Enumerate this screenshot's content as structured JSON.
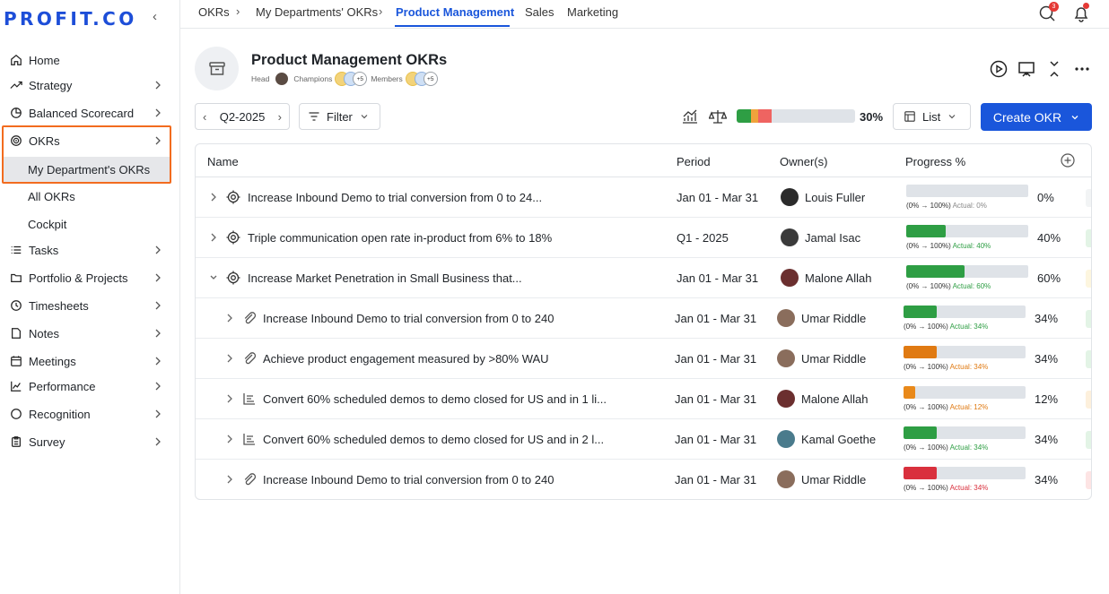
{
  "brand": {
    "logo_text": "PROFIT.CO",
    "accent": "#1a56db",
    "highlight": "#f26c1f"
  },
  "sidebar": {
    "items": [
      {
        "label": "Home",
        "icon": "home-icon",
        "chevron": false
      },
      {
        "label": "Strategy",
        "icon": "trend-up-icon",
        "chevron": true
      },
      {
        "label": "Balanced Scorecard",
        "icon": "pie-chart-icon",
        "chevron": true
      },
      {
        "label": "OKRs",
        "icon": "target-icon",
        "chevron": true
      },
      {
        "label": "Tasks",
        "icon": "list-icon",
        "chevron": true
      },
      {
        "label": "Portfolio & Projects",
        "icon": "folder-icon",
        "chevron": true
      },
      {
        "label": "Timesheets",
        "icon": "clock-icon",
        "chevron": true
      },
      {
        "label": "Notes",
        "icon": "note-icon",
        "chevron": true
      },
      {
        "label": "Meetings",
        "icon": "calendar-icon",
        "chevron": true
      },
      {
        "label": "Performance",
        "icon": "chart-icon",
        "chevron": true
      },
      {
        "label": "Recognition",
        "icon": "circle-icon",
        "chevron": true
      },
      {
        "label": "Survey",
        "icon": "clipboard-icon",
        "chevron": true
      }
    ],
    "okr_subitems": [
      "My Department's OKRs",
      "All OKRs",
      "Cockpit"
    ]
  },
  "topbar": {
    "tabs": [
      "OKRs",
      "My Departments' OKRs",
      "Product Management",
      "Sales",
      "Marketing"
    ],
    "active_tab": "Product Management",
    "notification_count": "3"
  },
  "header": {
    "title": "Product Management OKRs",
    "head_label": "Head",
    "champions_label": "Champions",
    "champions_more": "+5",
    "members_label": "Members",
    "members_more": "+5"
  },
  "toolbar": {
    "period": "Q2-2025",
    "filter_label": "Filter",
    "overall_progress": "30%",
    "view_label": "List",
    "create_label": "Create OKR"
  },
  "table": {
    "columns": [
      "Name",
      "Period",
      "Owner(s)",
      "Progress %"
    ],
    "rows": [
      {
        "level": 0,
        "expanded": false,
        "type": "objective",
        "name": "Increase Inbound Demo to trial conversion from 0 to 24...",
        "period": "Jan 01 - Mar 31",
        "owner": "Louis Fuller",
        "progress": 0,
        "bar_color": "#2e9e44",
        "range": "(0% → 100%)",
        "actual": "Actual: 0%",
        "actual_color": "#888888",
        "pct": "0%",
        "edge": "#f2f4f5"
      },
      {
        "level": 0,
        "expanded": false,
        "type": "objective",
        "name": "Triple communication open rate in-product from 6% to 18%",
        "period": "Q1 - 2025",
        "owner": "Jamal Isac",
        "progress": 40,
        "bar_color": "#2e9e44",
        "range": "(0% → 100%)",
        "actual": "Actual: 40%",
        "actual_color": "#2e9e44",
        "pct": "40%",
        "edge": "#e3f4e6"
      },
      {
        "level": 0,
        "expanded": true,
        "type": "objective",
        "name": "Increase Market Penetration in Small Business that...",
        "period": "Jan 01 - Mar 31",
        "owner": "Malone Allah",
        "progress": 60,
        "bar_color": "#2e9e44",
        "range": "(0% → 100%)",
        "actual": "Actual: 60%",
        "actual_color": "#2e9e44",
        "pct": "60%",
        "edge": "#fdf6df"
      },
      {
        "level": 1,
        "expanded": false,
        "type": "key-result",
        "name": "Increase Inbound Demo to trial conversion from 0 to 240",
        "period": "Jan 01 - Mar 31",
        "owner": "Umar Riddle",
        "progress": 34,
        "bar_color": "#2e9e44",
        "range": "(0% → 100%)",
        "actual": "Actual: 34%",
        "actual_color": "#2e9e44",
        "pct": "34%",
        "edge": "#e3f4e6"
      },
      {
        "level": 1,
        "expanded": false,
        "type": "key-result",
        "name": "Achieve product engagement measured by >80% WAU",
        "period": "Jan 01 - Mar 31",
        "owner": "Umar Riddle",
        "progress": 34,
        "bar_color": "#e07a12",
        "range": "(0% → 100%)",
        "actual": "Actual: 34%",
        "actual_color": "#e07a12",
        "pct": "34%",
        "edge": "#e3f4e6"
      },
      {
        "level": 1,
        "expanded": false,
        "type": "initiative",
        "name": "Convert 60% scheduled demos to demo closed for US  and in 1 li...",
        "period": "Jan 01 - Mar 31",
        "owner": "Malone Allah",
        "progress": 12,
        "bar_color": "#e9891a",
        "range": "(0% → 100%)",
        "actual": "Actual: 12%",
        "actual_color": "#e07a12",
        "pct": "12%",
        "edge": "#fdf0dc"
      },
      {
        "level": 1,
        "expanded": false,
        "type": "initiative",
        "name": "Convert 60% scheduled demos to demo closed for US  and in 2 l...",
        "period": "Jan 01 - Mar 31",
        "owner": "Kamal Goethe",
        "progress": 34,
        "bar_color": "#2e9e44",
        "range": "(0% → 100%)",
        "actual": "Actual: 34%",
        "actual_color": "#2e9e44",
        "pct": "34%",
        "edge": "#e3f4e6"
      },
      {
        "level": 1,
        "expanded": false,
        "type": "key-result",
        "name": "Increase Inbound Demo to trial conversion from 0 to 240",
        "period": "Jan 01 - Mar 31",
        "owner": "Umar Riddle",
        "progress": 34,
        "bar_color": "#d9303d",
        "range": "(0% → 100%)",
        "actual": "Actual: 34%",
        "actual_color": "#d9303d",
        "pct": "34%",
        "edge": "#fde4e4"
      }
    ]
  }
}
